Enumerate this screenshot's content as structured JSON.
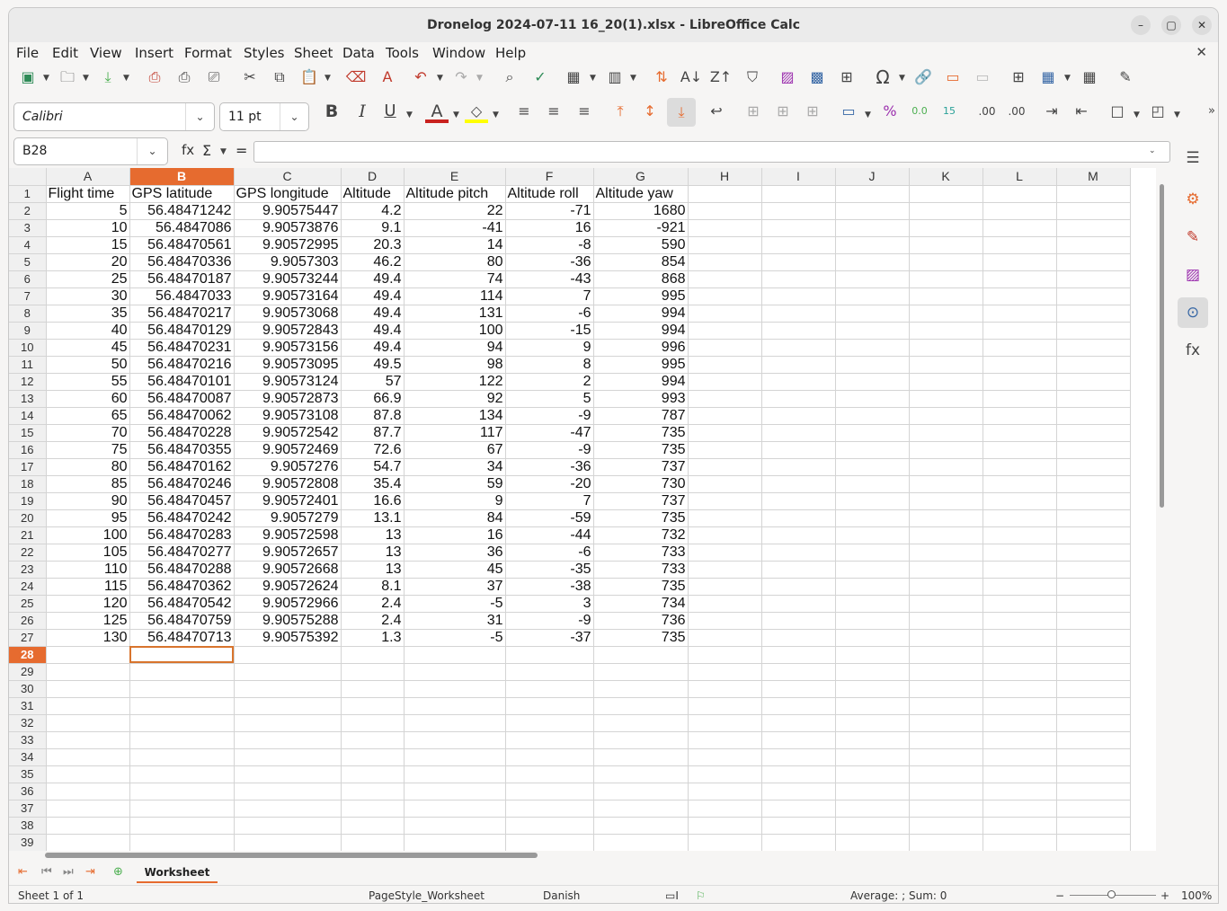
{
  "window": {
    "title": "Dronelog 2024-07-11 16_20(1).xlsx - LibreOffice Calc"
  },
  "menu": [
    "File",
    "Edit",
    "View",
    "Insert",
    "Format",
    "Styles",
    "Sheet",
    "Data",
    "Tools",
    "Window",
    "Help"
  ],
  "format": {
    "font_name": "Calibri",
    "font_size": "11 pt"
  },
  "formula": {
    "cell_ref": "B28",
    "content": ""
  },
  "columns": [
    "A",
    "B",
    "C",
    "D",
    "E",
    "F",
    "G",
    "H",
    "I",
    "J",
    "K",
    "L",
    "M"
  ],
  "selected_column": "B",
  "selected_row": 28,
  "header_row": [
    "Flight time",
    "GPS latitude",
    "GPS longitude",
    "Altitude",
    "Altitude pitch",
    "Altitude roll",
    "Altitude yaw"
  ],
  "rows": [
    [
      "5",
      "56.48471242",
      "9.90575447",
      "4.2",
      "22",
      "-71",
      "1680"
    ],
    [
      "10",
      "56.4847086",
      "9.90573876",
      "9.1",
      "-41",
      "16",
      "-921"
    ],
    [
      "15",
      "56.48470561",
      "9.90572995",
      "20.3",
      "14",
      "-8",
      "590"
    ],
    [
      "20",
      "56.48470336",
      "9.9057303",
      "46.2",
      "80",
      "-36",
      "854"
    ],
    [
      "25",
      "56.48470187",
      "9.90573244",
      "49.4",
      "74",
      "-43",
      "868"
    ],
    [
      "30",
      "56.4847033",
      "9.90573164",
      "49.4",
      "114",
      "7",
      "995"
    ],
    [
      "35",
      "56.48470217",
      "9.90573068",
      "49.4",
      "131",
      "-6",
      "994"
    ],
    [
      "40",
      "56.48470129",
      "9.90572843",
      "49.4",
      "100",
      "-15",
      "994"
    ],
    [
      "45",
      "56.48470231",
      "9.90573156",
      "49.4",
      "94",
      "9",
      "996"
    ],
    [
      "50",
      "56.48470216",
      "9.90573095",
      "49.5",
      "98",
      "8",
      "995"
    ],
    [
      "55",
      "56.48470101",
      "9.90573124",
      "57",
      "122",
      "2",
      "994"
    ],
    [
      "60",
      "56.48470087",
      "9.90572873",
      "66.9",
      "92",
      "5",
      "993"
    ],
    [
      "65",
      "56.48470062",
      "9.90573108",
      "87.8",
      "134",
      "-9",
      "787"
    ],
    [
      "70",
      "56.48470228",
      "9.90572542",
      "87.7",
      "117",
      "-47",
      "735"
    ],
    [
      "75",
      "56.48470355",
      "9.90572469",
      "72.6",
      "67",
      "-9",
      "735"
    ],
    [
      "80",
      "56.48470162",
      "9.9057276",
      "54.7",
      "34",
      "-36",
      "737"
    ],
    [
      "85",
      "56.48470246",
      "9.90572808",
      "35.4",
      "59",
      "-20",
      "730"
    ],
    [
      "90",
      "56.48470457",
      "9.90572401",
      "16.6",
      "9",
      "7",
      "737"
    ],
    [
      "95",
      "56.48470242",
      "9.9057279",
      "13.1",
      "84",
      "-59",
      "735"
    ],
    [
      "100",
      "56.48470283",
      "9.90572598",
      "13",
      "16",
      "-44",
      "732"
    ],
    [
      "105",
      "56.48470277",
      "9.90572657",
      "13",
      "36",
      "-6",
      "733"
    ],
    [
      "110",
      "56.48470288",
      "9.90572668",
      "13",
      "45",
      "-35",
      "733"
    ],
    [
      "115",
      "56.48470362",
      "9.90572624",
      "8.1",
      "37",
      "-38",
      "735"
    ],
    [
      "120",
      "56.48470542",
      "9.90572966",
      "2.4",
      "-5",
      "3",
      "734"
    ],
    [
      "125",
      "56.48470759",
      "9.90575288",
      "2.4",
      "31",
      "-9",
      "736"
    ],
    [
      "130",
      "56.48470713",
      "9.90575392",
      "1.3",
      "-5",
      "-37",
      "735"
    ]
  ],
  "total_rows_visible": 39,
  "sheet_tab": "Worksheet",
  "status": {
    "sheet": "Sheet 1 of 1",
    "page_style": "PageStyle_Worksheet",
    "language": "Danish",
    "summary": "Average: ; Sum: 0",
    "zoom": "100%"
  },
  "colors": {
    "accent": "#e66b2f"
  }
}
